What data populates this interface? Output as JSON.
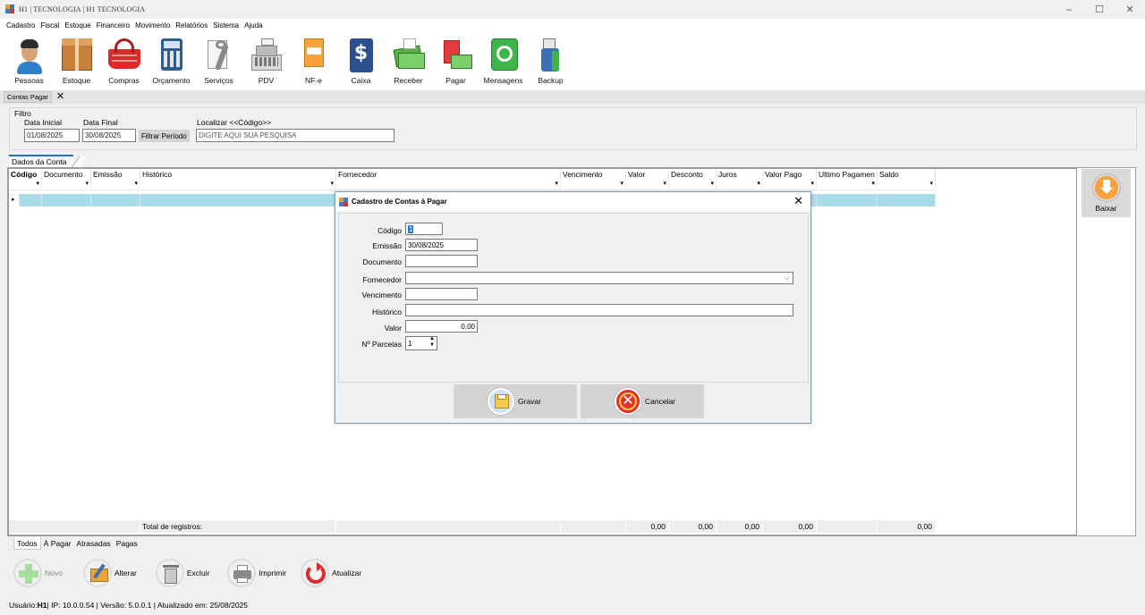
{
  "window": {
    "title": "H1 | TECNOLOGIA | H1 TECNOLOGIA",
    "minimize": "–",
    "maximize": "☐",
    "close": "✕"
  },
  "menu": [
    "Cadastro",
    "Fiscal",
    "Estoque",
    "Financeiro",
    "Movimento",
    "Relatórios",
    "Sistema",
    "Ajuda"
  ],
  "toolbar": [
    {
      "label": "Pessoas",
      "icon": "person-icon"
    },
    {
      "label": "Estoque",
      "icon": "box-icon"
    },
    {
      "label": "Compras",
      "icon": "basket-icon"
    },
    {
      "label": "Orçamento",
      "icon": "calculator-icon"
    },
    {
      "label": "Serviços",
      "icon": "wrench-icon"
    },
    {
      "label": "PDV",
      "icon": "cash-register-icon"
    },
    {
      "label": "NF-e",
      "icon": "invoice-icon"
    },
    {
      "label": "Caixa",
      "icon": "cash-box-icon"
    },
    {
      "label": "Receber",
      "icon": "money-receive-icon"
    },
    {
      "label": "Pagar",
      "icon": "money-pay-icon"
    },
    {
      "label": "Mensagens",
      "icon": "whatsapp-icon"
    },
    {
      "label": "Backup",
      "icon": "usb-drive-icon"
    }
  ],
  "doc_tab": {
    "label": "Contas Pagar",
    "close": "✕"
  },
  "filter": {
    "legend": "Filtro",
    "data_inicial_label": "Data Inicial",
    "data_inicial": "01/08/2025",
    "data_final_label": "Data Final",
    "data_final": "30/08/2025",
    "filtrar_button": "Filtrar Período",
    "localizar_label": "Localizar <<Código>>",
    "localizar_placeholder": "DIGITE AQUI SUA PESQUISA"
  },
  "data_tab": {
    "label": "Dados da Conta"
  },
  "grid": {
    "columns": [
      "Código",
      "Documento",
      "Emissão",
      "Histórico",
      "Fornecedor",
      "Vencimento",
      "Valor",
      "Desconto",
      "Juros",
      "Valor Pago",
      "Ultimo Pagamen",
      "Saldo"
    ],
    "row_marker": "▸",
    "total_label": "Total de registros:",
    "totals": {
      "valor": "0,00",
      "desconto": "0,00",
      "juros": "0,00",
      "valor_pago": "0,00",
      "saldo": "0,00"
    }
  },
  "baixar": {
    "label": "Baixar"
  },
  "status_tabs": [
    "Todos",
    "À Pagar",
    "Atrasadas",
    "Pagas"
  ],
  "actions": [
    {
      "label": "Novo",
      "icon": "plus-icon",
      "enabled": false
    },
    {
      "label": "Alterar",
      "icon": "edit-folder-icon",
      "enabled": true
    },
    {
      "label": "Excluir",
      "icon": "trash-icon",
      "enabled": true
    },
    {
      "label": "Imprimir",
      "icon": "printer-icon",
      "enabled": true
    },
    {
      "label": "Atualizar",
      "icon": "refresh-icon",
      "enabled": true
    }
  ],
  "statusbar": {
    "prefix": "Usuário: ",
    "user": "H1",
    "rest": " | IP: 10.0.0.54 | Versão: 5.0.0.1 | Atualizado em: 25/08/2025"
  },
  "dialog": {
    "title": "Cadastro de Contas à Pagar",
    "close": "✕",
    "fields": {
      "codigo_label": "Código",
      "codigo": "1",
      "emissao_label": "Emissão",
      "emissao": "30/08/2025",
      "documento_label": "Documento",
      "documento": "",
      "fornecedor_label": "Fornecedor",
      "fornecedor": "",
      "vencimento_label": "Vencimento",
      "vencimento": "",
      "historico_label": "Histórico",
      "historico": "",
      "valor_label": "Valor",
      "valor": "0,00",
      "parcelas_label": "Nº Parcelas",
      "parcelas": "1"
    },
    "gravar": "Gravar",
    "cancelar": "Cancelar"
  },
  "colors": {
    "accent": "#1e6fd0",
    "row_highlight": "#aadbe8"
  }
}
